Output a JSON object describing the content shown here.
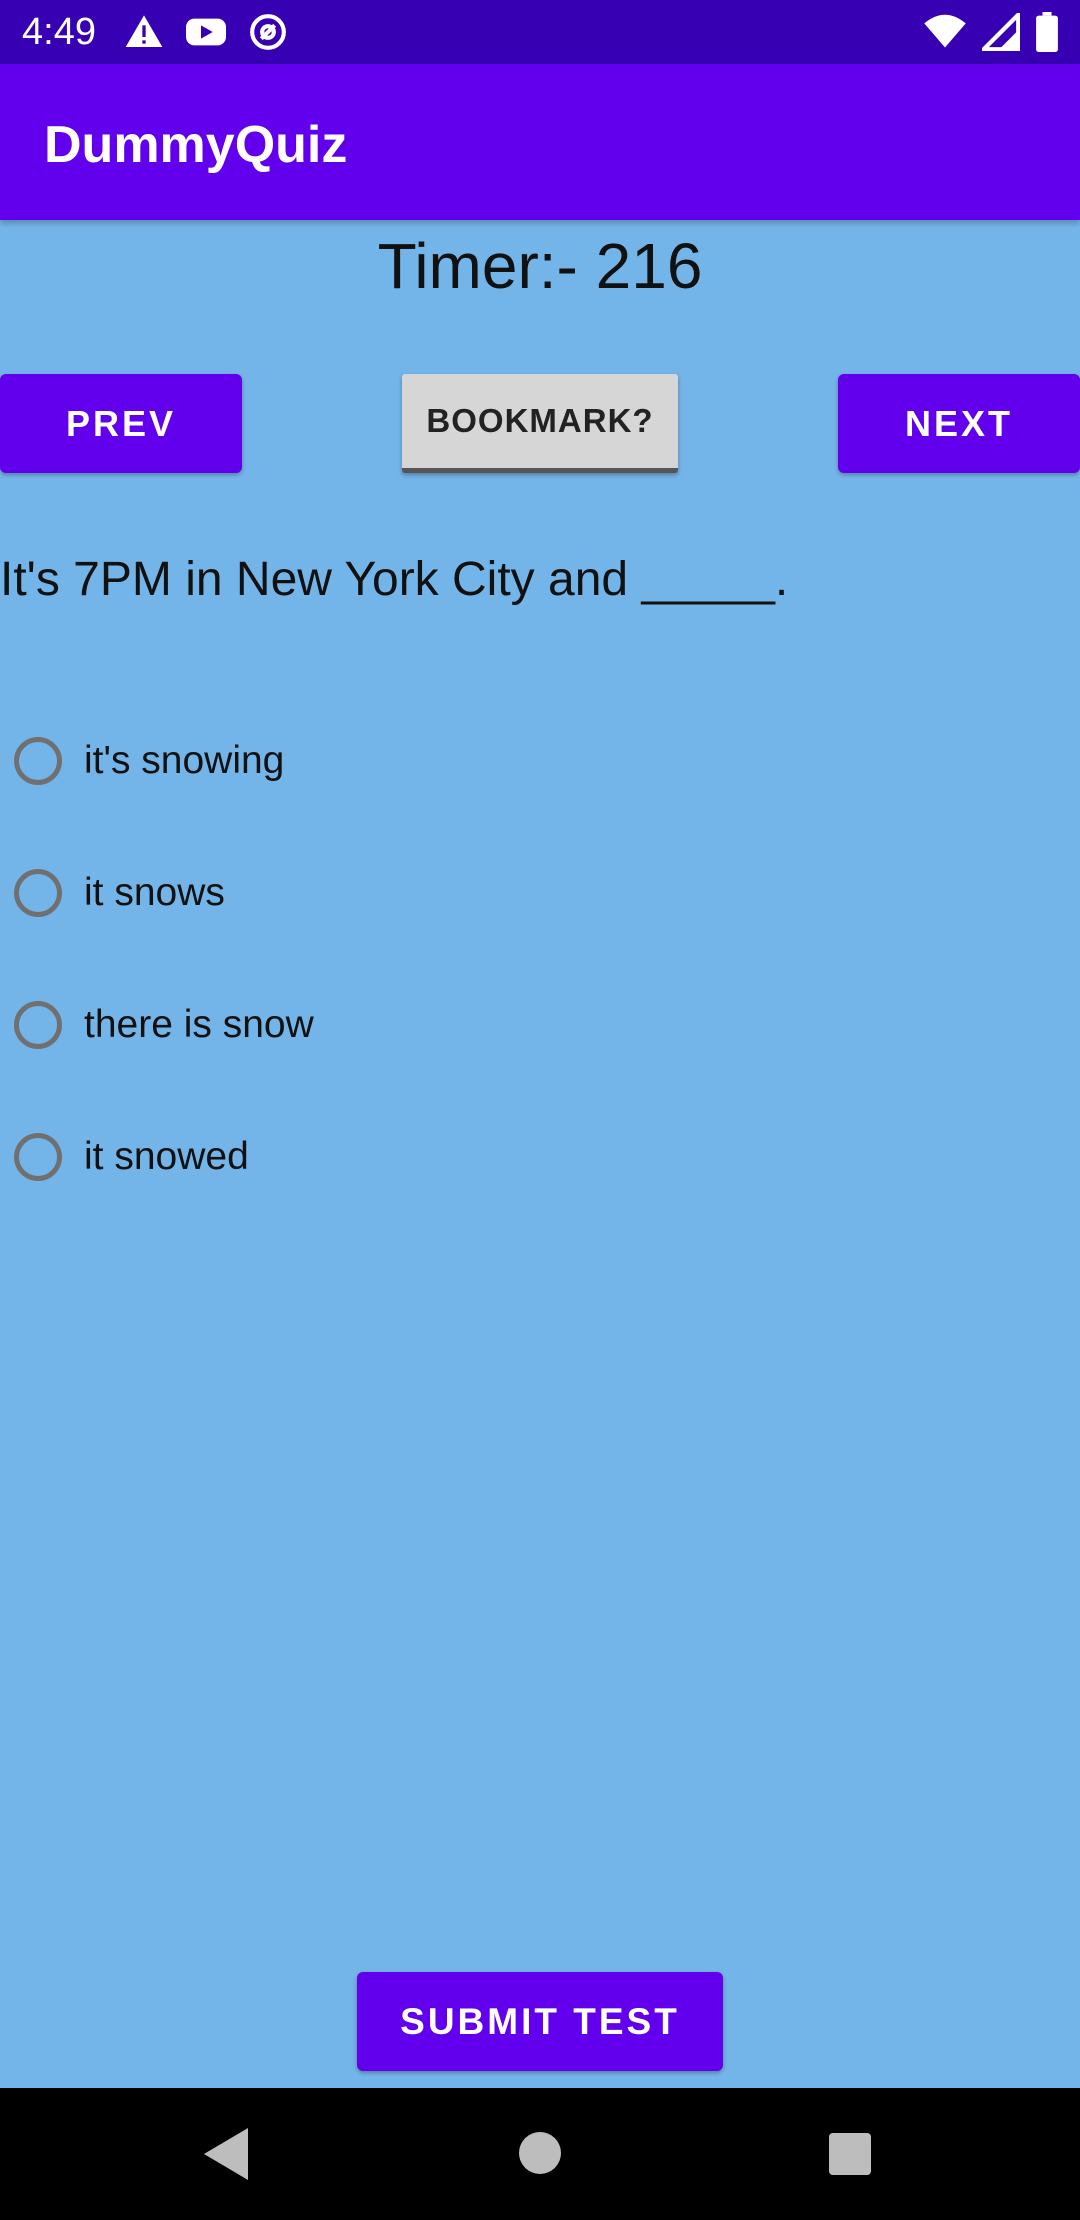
{
  "status_bar": {
    "time": "4:49",
    "left_icons": [
      "warning-icon",
      "youtube-icon",
      "at-sign-icon"
    ],
    "right_icons": [
      "wifi-icon",
      "signal-icon",
      "battery-icon"
    ]
  },
  "app_bar": {
    "title": "DummyQuiz"
  },
  "timer": {
    "text": "Timer:- 216"
  },
  "buttons": {
    "prev": "PREV",
    "bookmark": "BOOKMARK?",
    "next": "NEXT",
    "submit": "SUBMIT TEST"
  },
  "question": {
    "text": "It's 7PM in New York City and _____."
  },
  "options": [
    {
      "label": "it's snowing",
      "selected": false
    },
    {
      "label": "it snows",
      "selected": false
    },
    {
      "label": "there is snow",
      "selected": false
    },
    {
      "label": "it snowed",
      "selected": false
    }
  ],
  "colors": {
    "background": "#74b5e9",
    "primary": "#6200ee",
    "status_bar": "#3700b3",
    "bookmark_button": "#d6d6d6"
  },
  "nav_bar": {
    "icons": [
      "back-icon",
      "home-icon",
      "recents-icon"
    ]
  }
}
